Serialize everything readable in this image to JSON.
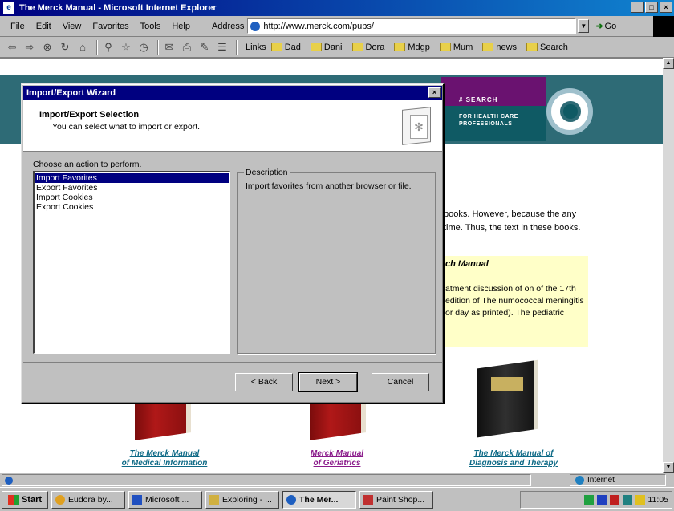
{
  "window": {
    "title": "The Merck Manual - Microsoft Internet Explorer",
    "minimize": "_",
    "maximize": "□",
    "close": "×"
  },
  "menu": [
    "File",
    "Edit",
    "View",
    "Favorites",
    "Tools",
    "Help"
  ],
  "address": {
    "label": "Address",
    "url": "http://www.merck.com/pubs/",
    "dropdown": "▼",
    "go_label": "Go",
    "go_arrow": "➜"
  },
  "toolbar": {
    "nav_icons": [
      "back-icon",
      "forward-icon",
      "stop-icon",
      "refresh-icon",
      "home-icon",
      "search-icon",
      "favorites-icon",
      "history-icon",
      "mail-icon",
      "print-icon",
      "edit-icon",
      "discuss-icon"
    ],
    "links_label": "Links",
    "links": [
      "Dad",
      "Dani",
      "Dora",
      "Mdgp",
      "Mum",
      "news",
      "Search"
    ]
  },
  "webpage": {
    "nav_search": "# SEARCH",
    "nav_hcp": "FOR HEALTH CARE PROFESSIONALS",
    "paragraph": "books. However, because the any time. Thus, the text in these books.",
    "yellow_title": "ch Manual",
    "yellow_text": "atment discussion of on of the 17th edition of The numococcal meningitis or day as printed). The pediatric",
    "book_captions": [
      {
        "line1": "The Merck Manual",
        "line2": "of Medical Information"
      },
      {
        "line1": "Merck Manual",
        "line2": "of Geriatrics"
      },
      {
        "line1": "The Merck Manual of",
        "line2": "Diagnosis and Therapy"
      }
    ],
    "colors": {
      "header": "#2e6b76",
      "nav_purple": "#6a1270",
      "yellow_box": "#ffffc8",
      "link_teal": "#0e6a86",
      "link_purple": "#8a1a8a"
    }
  },
  "dialog": {
    "title": "Import/Export Wizard",
    "close": "×",
    "heading": "Import/Export Selection",
    "subheading": "You can select what to import or export.",
    "choose_label": "Choose an action to perform.",
    "actions": [
      "Import Favorites",
      "Export Favorites",
      "Import Cookies",
      "Export Cookies"
    ],
    "selected_action": "Import Favorites",
    "description_label": "Description",
    "description_text": "Import favorites from another browser or file.",
    "buttons": {
      "back": "< Back",
      "next": "Next >",
      "cancel": "Cancel"
    }
  },
  "statusbar": {
    "zone": "Internet"
  },
  "taskbar": {
    "start": "Start",
    "tasks": [
      {
        "label": "Eudora by...",
        "active": false
      },
      {
        "label": "Microsoft ...",
        "active": false
      },
      {
        "label": "Exploring - ...",
        "active": false
      },
      {
        "label": "The Mer...",
        "active": true
      },
      {
        "label": "Paint Shop...",
        "active": false
      }
    ],
    "clock": "11:05"
  }
}
